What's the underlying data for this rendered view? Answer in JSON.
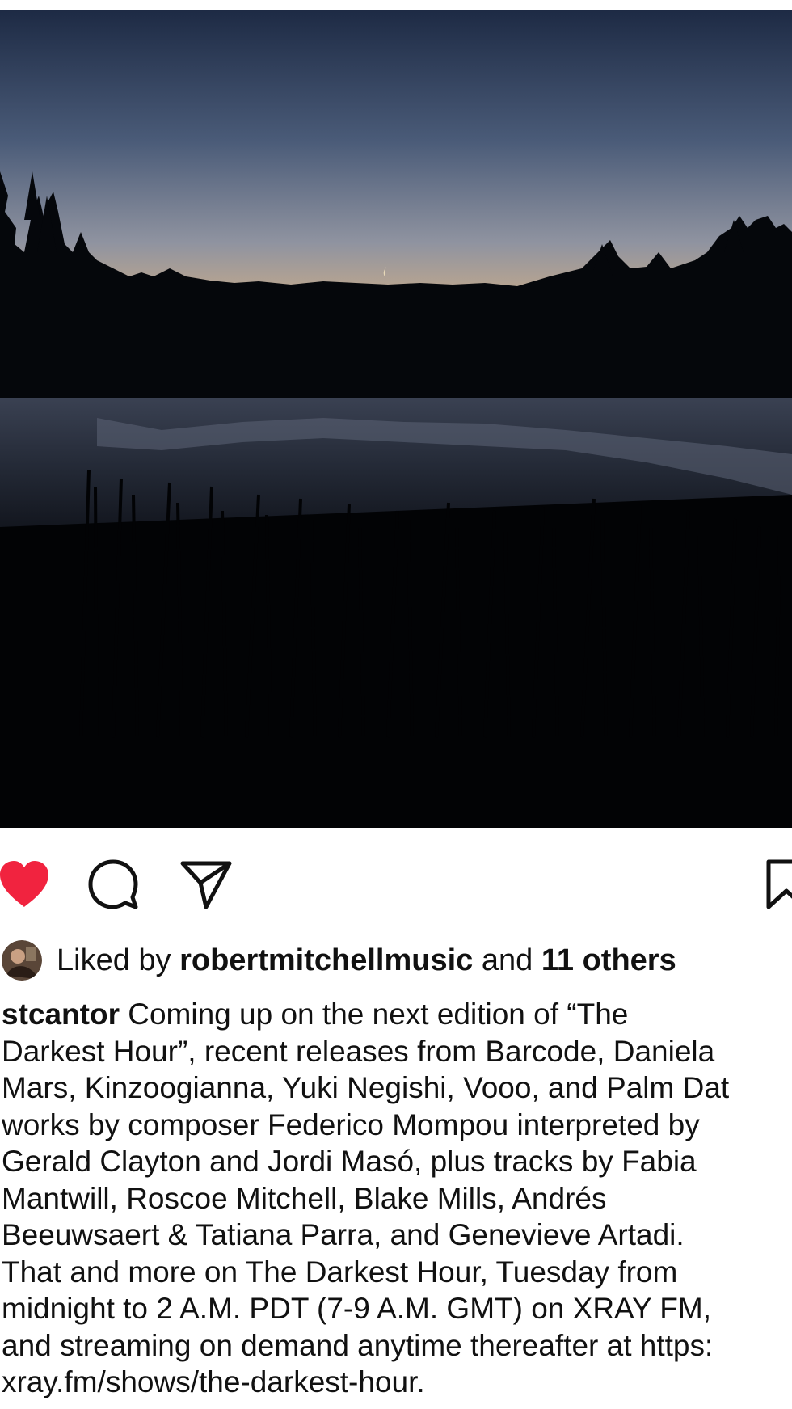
{
  "post": {
    "image_alt": "Twilight over a still lake with silhouetted pine trees, reeds in the foreground and a thin crescent moon reflected in the water",
    "liked": true,
    "colors": {
      "like_red": "#f1233f",
      "text": "#111111"
    }
  },
  "actions": {
    "like": "heart-icon",
    "comment": "comment-icon",
    "share": "paper-plane-icon",
    "save": "bookmark-icon"
  },
  "likes": {
    "prefix": "Liked by ",
    "user": "robertmitchellmusic",
    "middle": " and ",
    "others": "11 others"
  },
  "caption": {
    "username": "stcantor",
    "lines": [
      " Coming up on the next edition of “The",
      "Darkest Hour”, recent releases from Barcode, Daniela",
      "Mars, Kinzoogianna, Yuki Negishi, Vooo, and Palm Dat",
      "works by composer Federico Mompou interpreted by",
      "Gerald Clayton and Jordi Masó, plus tracks by Fabia",
      "Mantwill, Roscoe Mitchell, Blake Mills, Andrés",
      "Beeuwsaert & Tatiana Parra, and Genevieve Artadi.",
      "That and more on The Darkest Hour, Tuesday from",
      "midnight to 2 A.M. PDT (7-9 A.M. GMT) on XRAY FM,",
      "and streaming on demand anytime thereafter at https:",
      "xray.fm/shows/the-darkest-hour."
    ]
  }
}
